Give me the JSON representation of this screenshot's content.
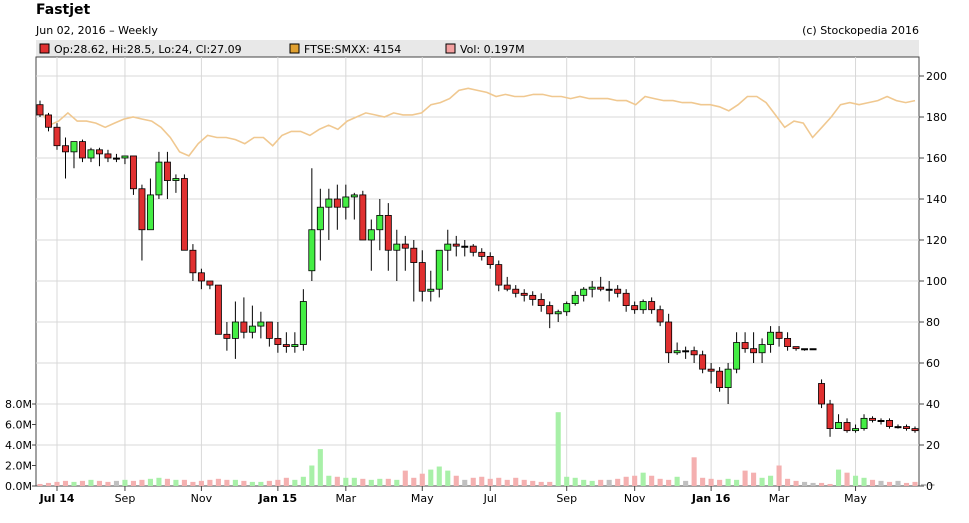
{
  "header": {
    "title": "Fastjet",
    "subtitle": "Jun 02, 2016 – Weekly",
    "copyright": "(c) Stockopedia 2016"
  },
  "legend": {
    "items": [
      {
        "label": "Op:28.62, Hi:28.5, Lo:24, Cl:27.09",
        "color": "#e03030"
      },
      {
        "label": "FTSE:SMXX: 4154",
        "color": "#e0a030"
      },
      {
        "label": "Vol: 0.197M",
        "color": "#f4a0a0"
      }
    ]
  },
  "chart_data": {
    "type": "candlestick",
    "price_axis": {
      "ticks": [
        "200",
        "180",
        "160",
        "140",
        "120",
        "100",
        "80",
        "60",
        "40",
        "20",
        "0"
      ],
      "min": 0,
      "max": 200
    },
    "volume_axis": {
      "ticks": [
        "8.0M",
        "6.0M",
        "4.0M",
        "2.0M",
        "0.0M"
      ],
      "min": 0,
      "max": 8
    },
    "x_ticks": [
      {
        "label": "Jul 14",
        "index": 2,
        "bold": true
      },
      {
        "label": "Sep",
        "index": 10,
        "bold": false
      },
      {
        "label": "Nov",
        "index": 19,
        "bold": false
      },
      {
        "label": "Jan 15",
        "index": 28,
        "bold": true
      },
      {
        "label": "Mar",
        "index": 36,
        "bold": false
      },
      {
        "label": "May",
        "index": 45,
        "bold": false
      },
      {
        "label": "Jul",
        "index": 53,
        "bold": false
      },
      {
        "label": "Sep",
        "index": 62,
        "bold": false
      },
      {
        "label": "Nov",
        "index": 70,
        "bold": false
      },
      {
        "label": "Jan 16",
        "index": 79,
        "bold": true
      },
      {
        "label": "Mar",
        "index": 87,
        "bold": false
      },
      {
        "label": "May",
        "index": 96,
        "bold": false
      }
    ],
    "colors": {
      "up": "#44ee44",
      "down": "#e03030",
      "index_line": "#f0c890",
      "vol_up": "#a8f0a8",
      "vol_down": "#f4b0b0",
      "vol_flat": "#c0c0c0"
    },
    "ohlc": [
      [
        186,
        188,
        180,
        181
      ],
      [
        181,
        182,
        173,
        175
      ],
      [
        175,
        177,
        164,
        166
      ],
      [
        166,
        170,
        150,
        163
      ],
      [
        163,
        168,
        155,
        168
      ],
      [
        168,
        169,
        158,
        160
      ],
      [
        160,
        165,
        158,
        164
      ],
      [
        164,
        165,
        156,
        162
      ],
      [
        162,
        164,
        158,
        160
      ],
      [
        160,
        162,
        158,
        160
      ],
      [
        160,
        161,
        157,
        161
      ],
      [
        161,
        161,
        142,
        145
      ],
      [
        145,
        147,
        110,
        125
      ],
      [
        125,
        150,
        125,
        142
      ],
      [
        142,
        163,
        140,
        158
      ],
      [
        158,
        163,
        140,
        149
      ],
      [
        149,
        152,
        143,
        150
      ],
      [
        150,
        152,
        115,
        115
      ],
      [
        115,
        118,
        100,
        104
      ],
      [
        104,
        106,
        96,
        100
      ],
      [
        100,
        100,
        96,
        98
      ],
      [
        98,
        98,
        75,
        74
      ],
      [
        74,
        80,
        66,
        72
      ],
      [
        72,
        90,
        62,
        80
      ],
      [
        80,
        92,
        72,
        75
      ],
      [
        75,
        88,
        72,
        78
      ],
      [
        78,
        85,
        72,
        80
      ],
      [
        80,
        80,
        68,
        72
      ],
      [
        72,
        80,
        65,
        69
      ],
      [
        69,
        75,
        65,
        68
      ],
      [
        68,
        75,
        65,
        69
      ],
      [
        69,
        96,
        66,
        90
      ],
      [
        105,
        155,
        100,
        125
      ],
      [
        125,
        145,
        110,
        136
      ],
      [
        136,
        145,
        120,
        140
      ],
      [
        140,
        147,
        125,
        136
      ],
      [
        136,
        147,
        130,
        141
      ],
      [
        141,
        143,
        130,
        142
      ],
      [
        142,
        144,
        120,
        120
      ],
      [
        120,
        130,
        105,
        125
      ],
      [
        125,
        140,
        115,
        132
      ],
      [
        132,
        138,
        105,
        115
      ],
      [
        115,
        125,
        100,
        118
      ],
      [
        118,
        122,
        105,
        116
      ],
      [
        116,
        120,
        90,
        109
      ],
      [
        109,
        115,
        90,
        95
      ],
      [
        95,
        105,
        90,
        96
      ],
      [
        96,
        115,
        92,
        115
      ],
      [
        115,
        125,
        105,
        118
      ],
      [
        118,
        122,
        112,
        117
      ],
      [
        117,
        120,
        112,
        117
      ],
      [
        117,
        118,
        112,
        114
      ],
      [
        114,
        116,
        110,
        112
      ],
      [
        112,
        114,
        106,
        108
      ],
      [
        108,
        110,
        95,
        98
      ],
      [
        98,
        102,
        95,
        96
      ],
      [
        96,
        98,
        92,
        94
      ],
      [
        94,
        96,
        90,
        93
      ],
      [
        93,
        95,
        88,
        91
      ],
      [
        91,
        94,
        85,
        88
      ],
      [
        88,
        90,
        77,
        84
      ],
      [
        84,
        86,
        80,
        85
      ],
      [
        85,
        90,
        83,
        89
      ],
      [
        89,
        95,
        88,
        93
      ],
      [
        93,
        97,
        90,
        96
      ],
      [
        96,
        100,
        92,
        97
      ],
      [
        97,
        102,
        95,
        96
      ],
      [
        96,
        100,
        90,
        96
      ],
      [
        96,
        98,
        92,
        94
      ],
      [
        94,
        96,
        85,
        88
      ],
      [
        88,
        90,
        84,
        86
      ],
      [
        86,
        91,
        84,
        90
      ],
      [
        90,
        92,
        84,
        86
      ],
      [
        86,
        88,
        78,
        80
      ],
      [
        80,
        84,
        60,
        65
      ],
      [
        65,
        70,
        64,
        66
      ],
      [
        66,
        68,
        62,
        66
      ],
      [
        66,
        68,
        60,
        64
      ],
      [
        64,
        66,
        55,
        57
      ],
      [
        57,
        60,
        50,
        56
      ],
      [
        56,
        58,
        46,
        48
      ],
      [
        48,
        60,
        40,
        57
      ],
      [
        57,
        75,
        55,
        70
      ],
      [
        70,
        75,
        65,
        67
      ],
      [
        67,
        75,
        60,
        65
      ],
      [
        65,
        72,
        60,
        69
      ],
      [
        69,
        78,
        65,
        75
      ],
      [
        75,
        78,
        68,
        72
      ],
      [
        72,
        75,
        66,
        68
      ],
      [
        68,
        68,
        66,
        67
      ],
      [
        67,
        67,
        66,
        67
      ],
      [
        67,
        67,
        67,
        67
      ],
      [
        50,
        52,
        38,
        40
      ],
      [
        40,
        42,
        24,
        28
      ],
      [
        28,
        35,
        28,
        31
      ],
      [
        31,
        33,
        26,
        27
      ],
      [
        27,
        30,
        26,
        28
      ],
      [
        28,
        35,
        27,
        33
      ],
      [
        33,
        34,
        31,
        32
      ],
      [
        32,
        33,
        30,
        32
      ],
      [
        32,
        33,
        28,
        29
      ],
      [
        29,
        30,
        28,
        29
      ],
      [
        29,
        30,
        27,
        28
      ],
      [
        28,
        29,
        26,
        27
      ]
    ],
    "index": [
      184,
      176,
      178,
      182,
      178,
      178,
      177,
      175,
      177,
      179,
      180,
      179,
      178,
      175,
      170,
      163,
      161,
      167,
      171,
      170,
      170,
      169,
      167,
      170,
      170,
      166,
      171,
      173,
      173,
      171,
      174,
      176,
      174,
      178,
      180,
      182,
      181,
      180,
      182,
      181,
      181,
      182,
      186,
      187,
      189,
      193,
      194,
      193,
      192,
      190,
      191,
      190,
      190,
      191,
      191,
      190,
      190,
      189,
      190,
      189,
      189,
      189,
      188,
      188,
      186,
      190,
      189,
      188,
      188,
      187,
      187,
      186,
      186,
      185,
      183,
      186,
      190,
      190,
      187,
      181,
      175,
      178,
      177,
      170,
      175,
      180,
      186,
      187,
      186,
      187,
      188,
      190,
      188,
      187,
      188
    ],
    "volume": [
      0.2,
      0.3,
      0.4,
      0.5,
      0.4,
      0.5,
      0.6,
      0.5,
      0.4,
      0.5,
      0.6,
      0.5,
      0.6,
      0.7,
      0.8,
      0.7,
      0.6,
      0.6,
      0.4,
      0.5,
      0.6,
      0.7,
      0.6,
      0.6,
      0.5,
      0.4,
      0.4,
      0.5,
      0.6,
      0.8,
      0.6,
      0.9,
      2.0,
      3.6,
      1.0,
      0.9,
      0.8,
      0.8,
      0.7,
      0.6,
      0.7,
      0.7,
      0.6,
      1.5,
      0.8,
      1.2,
      1.6,
      1.9,
      1.5,
      1.0,
      0.6,
      0.8,
      0.9,
      0.7,
      0.8,
      0.6,
      0.8,
      0.6,
      0.5,
      0.4,
      0.4,
      7.2,
      0.9,
      0.8,
      0.6,
      0.5,
      0.6,
      0.6,
      0.7,
      0.9,
      1.0,
      1.3,
      1.0,
      0.7,
      0.6,
      0.9,
      0.5,
      2.8,
      0.8,
      0.7,
      0.6,
      0.7,
      0.6,
      1.5,
      1.3,
      0.8,
      1.0,
      2.0,
      0.7,
      0.5,
      0.4,
      0.3,
      0.3,
      0.2,
      1.6,
      1.3,
      1.0,
      0.8,
      0.6,
      0.5,
      0.4,
      0.5,
      0.3,
      0.4,
      0.2,
      0.2
    ]
  }
}
